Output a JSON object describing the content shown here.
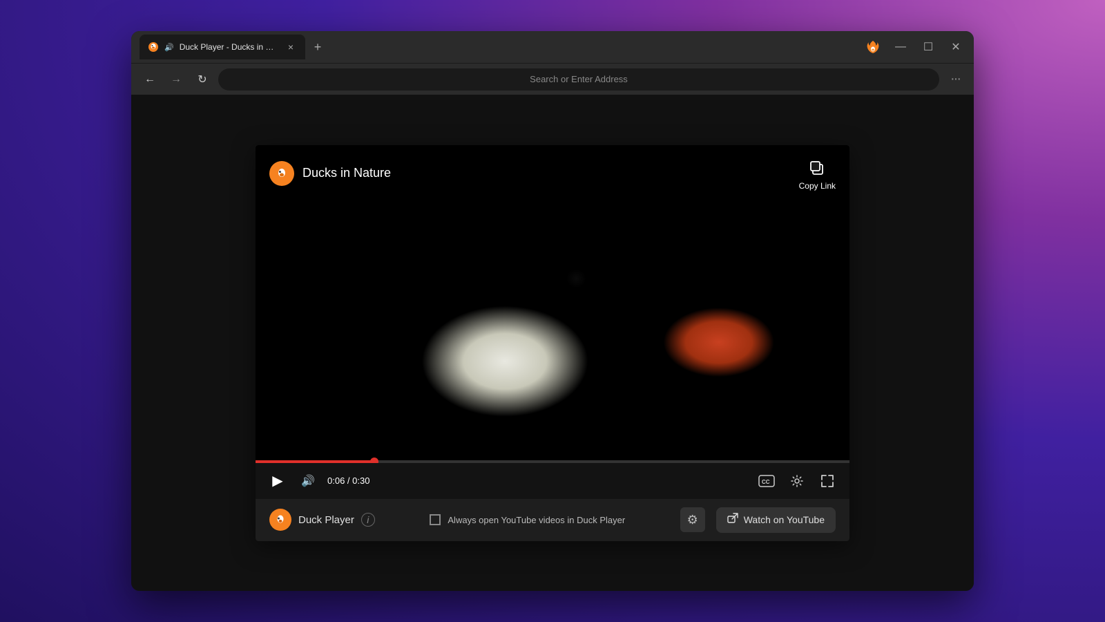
{
  "browser": {
    "tab": {
      "title": "Duck Player - Ducks in Nature...",
      "audio_indicator": "🔊",
      "close_label": "×"
    },
    "new_tab_label": "+",
    "window_controls": {
      "ddg_logo": "🦆",
      "minimize": "—",
      "maximize": "☐",
      "close": "✕"
    },
    "nav": {
      "back_label": "←",
      "forward_label": "→",
      "refresh_label": "↻",
      "address_placeholder": "Search or Enter Address",
      "menu_label": "···"
    }
  },
  "video": {
    "title": "Ducks in Nature",
    "copy_link_label": "Copy Link",
    "copy_link_icon": "⧉",
    "time_current": "0:06",
    "time_total": "0:30",
    "time_display": "0:06 / 0:30",
    "progress_percent": 20,
    "controls": {
      "play_label": "▶",
      "volume_label": "🔊",
      "captions_label": "CC",
      "settings_label": "⚙",
      "fullscreen_label": "⛶"
    }
  },
  "bottom_bar": {
    "duck_player_label": "Duck Player",
    "info_label": "i",
    "always_open_label": "Always open YouTube videos in Duck Player",
    "settings_label": "⚙",
    "watch_youtube_label": "Watch on YouTube",
    "watch_youtube_icon": "↗"
  }
}
